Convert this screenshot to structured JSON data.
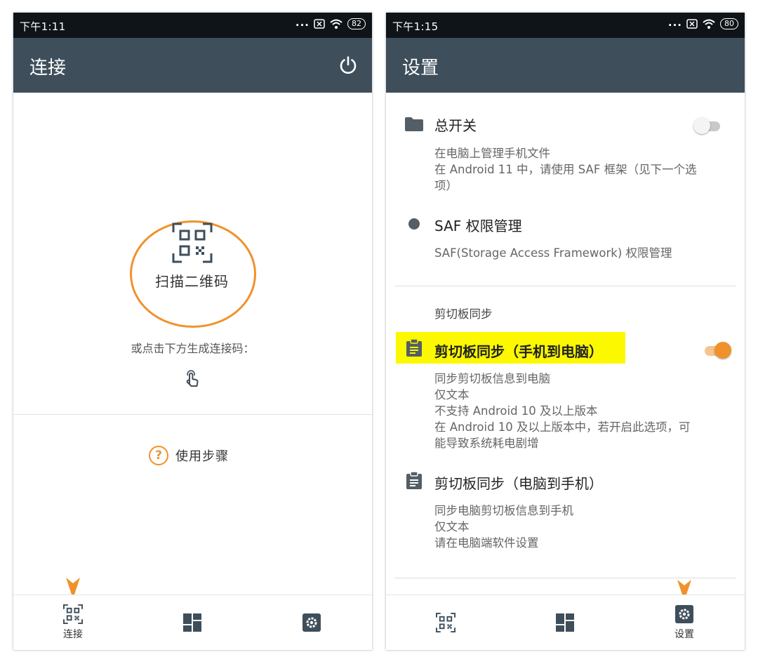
{
  "left": {
    "status": {
      "time": "下午1:11",
      "dots": "...",
      "battery": "82"
    },
    "appbar": {
      "title": "连接"
    },
    "scan_label": "扫描二维码",
    "hint": "或点击下方生成连接码：",
    "steps_icon": "?",
    "steps_label": "使用步骤",
    "nav": {
      "connect_label": "连接"
    }
  },
  "right": {
    "status": {
      "time": "下午1:15",
      "dots": "...",
      "battery": "80"
    },
    "appbar": {
      "title": "设置"
    },
    "prefs": {
      "master": {
        "title": "总开关",
        "summary_lines": [
          "在电脑上管理手机文件",
          "在 Android 11 中，请使用 SAF 框架（见下一个选",
          "项）"
        ],
        "checked": false
      },
      "saf": {
        "title": "SAF 权限管理",
        "summary": "SAF(Storage Access Framework) 权限管理"
      },
      "category": "剪切板同步",
      "clip_to_pc": {
        "title": "剪切板同步（手机到电脑）",
        "summary_lines": [
          "同步剪切板信息到电脑",
          "仅文本",
          "不支持 Android 10 及以上版本",
          "在 Android 10 及以上版本中，若开启此选项，可",
          "能导致系统耗电剧增"
        ],
        "checked": true
      },
      "clip_to_phone": {
        "title": "剪切板同步（电脑到手机）",
        "summary_lines": [
          "同步电脑剪切板信息到手机",
          "仅文本",
          "请在电脑端软件设置"
        ]
      }
    },
    "nav": {
      "settings_label": "设置"
    }
  },
  "colors": {
    "appbar": "#3e4e5b",
    "statusbar": "#0f1418",
    "accent": "#f0922b",
    "highlight": "#fbf800"
  },
  "icons": [
    "power-icon",
    "qr-scan-icon",
    "touch-icon",
    "help-icon",
    "folder-icon",
    "dot-icon",
    "clipboard-icon",
    "dashboard-icon",
    "settings-icon",
    "arrow-marker-icon"
  ]
}
